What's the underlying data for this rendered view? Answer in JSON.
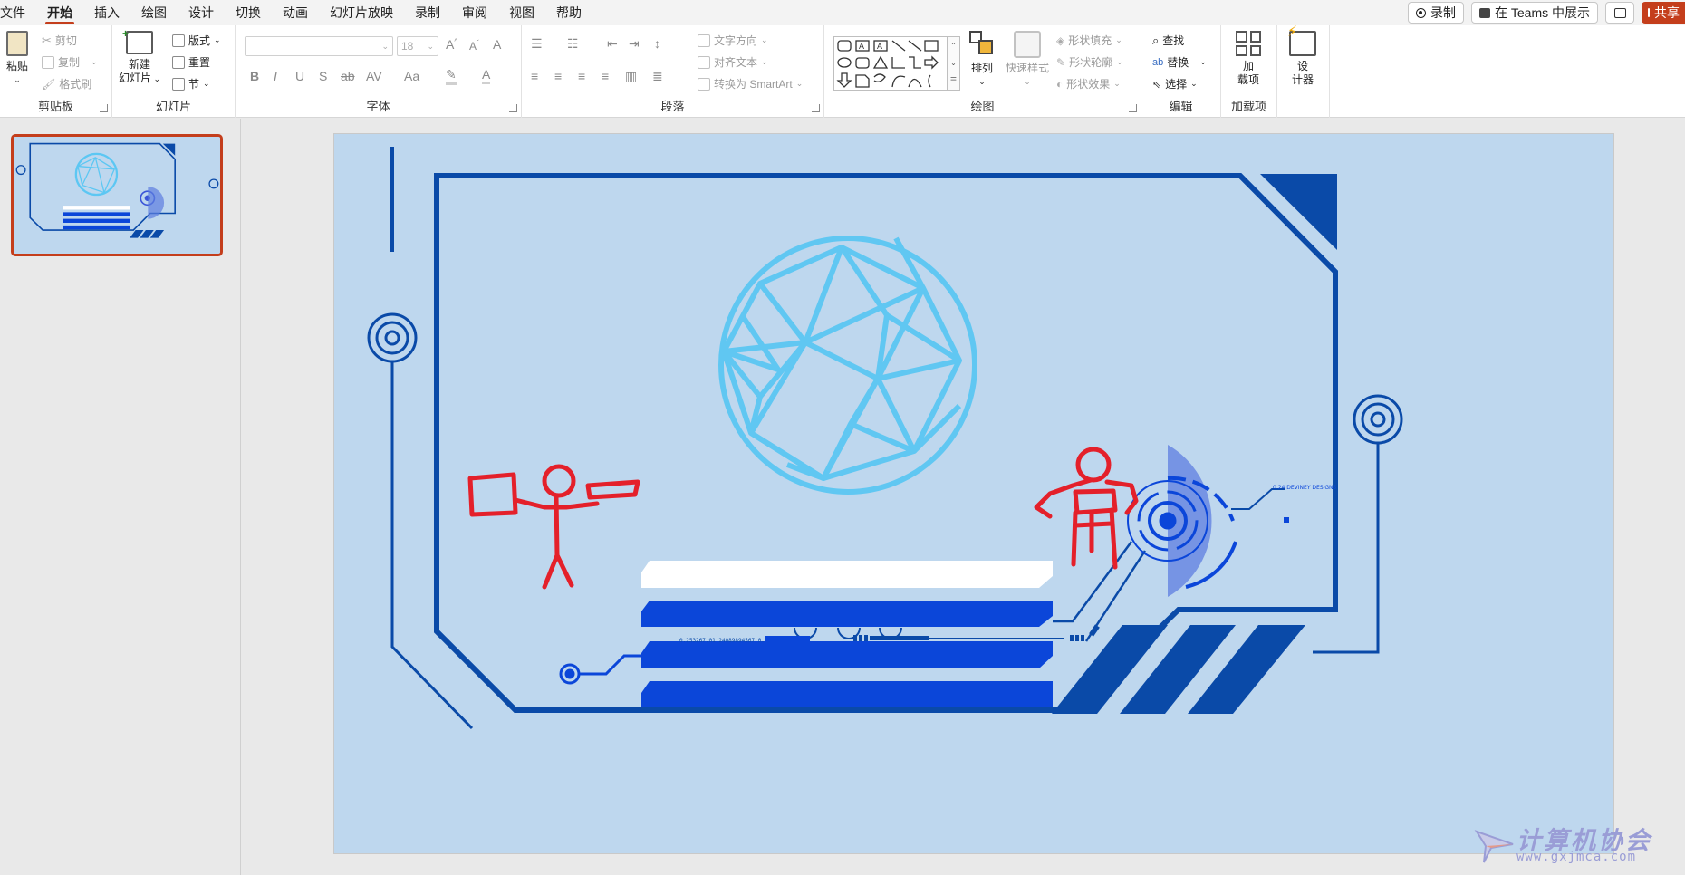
{
  "menu": {
    "tabs": [
      "文件",
      "开始",
      "插入",
      "绘图",
      "设计",
      "切换",
      "动画",
      "幻灯片放映",
      "录制",
      "审阅",
      "视图",
      "帮助"
    ],
    "active_tab": "开始",
    "record_label": "录制",
    "teams_label": "在 Teams 中展示",
    "share_label": "共享"
  },
  "ribbon": {
    "clipboard": {
      "label": "剪贴板",
      "paste": "粘贴",
      "cut": "剪切",
      "copy": "复制",
      "format_painter": "格式刷"
    },
    "slides": {
      "label": "幻灯片",
      "new_slide_line1": "新建",
      "new_slide_line2": "幻灯片",
      "layout": "版式",
      "reset": "重置",
      "section": "节"
    },
    "font": {
      "label": "字体",
      "font_name": "",
      "font_size": "18"
    },
    "paragraph": {
      "label": "段落",
      "text_direction": "文字方向",
      "align_text": "对齐文本",
      "convert_smartart": "转换为 SmartArt"
    },
    "drawing": {
      "label": "绘图",
      "arrange": "排列",
      "quick_styles": "快速样式",
      "shape_fill": "形状填充",
      "shape_outline": "形状轮廓",
      "shape_effects": "形状效果"
    },
    "editing": {
      "label": "编辑",
      "find": "查找",
      "replace": "替换",
      "select": "选择"
    },
    "addins": {
      "label": "加载项",
      "addins_line1": "加",
      "addins_line2": "载项",
      "designer_line1": "设",
      "designer_line2": "计器"
    }
  },
  "slide": {
    "hud_label_1": "0.24 DEVINEY DESIGNS",
    "hud_label_2": "0.253267.01     24089894567     0.24"
  },
  "watermark": {
    "title": "计算机协会",
    "url": "www.gxjmca.com"
  },
  "colors": {
    "accent": "#c43e1c",
    "slide_bg": "#bed7ee",
    "frame_blue": "#0a4aa8",
    "bar_blue": "#0b46d9",
    "globe_cyan": "#5cc7f3",
    "figure_red": "#e4202a"
  }
}
